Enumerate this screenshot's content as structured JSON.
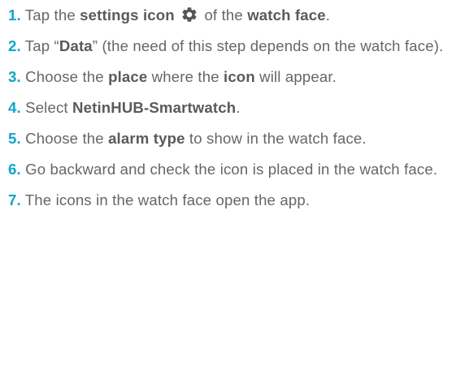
{
  "colors": {
    "step_number": "#0ea6c8",
    "text": "#666666",
    "emphasis": "#5a5a5a",
    "icon": "#555555"
  },
  "steps": [
    {
      "number": "1.",
      "t1": "Tap the ",
      "b1": "settings icon",
      "icon": "gear-icon",
      "t2": " of the ",
      "b2": "watch face",
      "t3": "."
    },
    {
      "number": "2.",
      "t1": "Tap “",
      "b1": "Data",
      "t2": "” (the need of this step depends on the watch face)."
    },
    {
      "number": "3.",
      "t1": "Choose the ",
      "b1": "place",
      "t2": " where the ",
      "b2": "icon",
      "t3": " will appear."
    },
    {
      "number": "4.",
      "t1": "Select ",
      "b1": "NetinHUB-Smartwatch",
      "t2": "."
    },
    {
      "number": "5.",
      "t1": "Choose the ",
      "b1": "alarm type",
      "t2": " to show in the watch face."
    },
    {
      "number": "6.",
      "t1": "Go backward and check the icon is placed in the watch face."
    },
    {
      "number": "7.",
      "t1": "The icons in the watch face open the app."
    }
  ]
}
